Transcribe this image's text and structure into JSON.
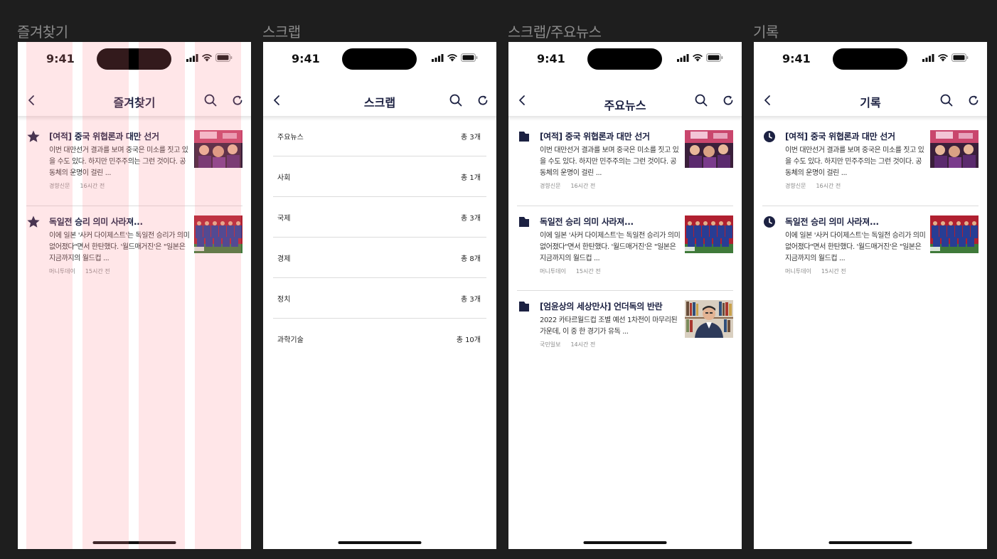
{
  "status_time": "9:41",
  "frames": [
    {
      "label": "즐겨찾기",
      "nav_title": "즐겨찾기"
    },
    {
      "label": "스크랩",
      "nav_title": "스크랩"
    },
    {
      "label": "스크랩/주요뉴스",
      "nav_title": "주요뉴스"
    },
    {
      "label": "기록",
      "nav_title": "기록"
    }
  ],
  "icons": {
    "favorite": "star-icon",
    "scrap": "folder-icon",
    "history": "clock-icon",
    "back": "chevron-left-icon",
    "search": "search-icon",
    "refresh": "refresh-icon"
  },
  "colors": {
    "accent": "#1c2142",
    "grid_overlay": "#ff828c"
  },
  "articles": {
    "a1": {
      "title": "[여적] 중국 위협론과 대만 선거",
      "summary": "이번 대만선거 결과를 보며 중국은 미소를 짓고 있을 수도 있다. 하지만 민주주의는 그런 것이다. 공동체의 운명이 걸린 ...",
      "source": "경향신문",
      "time": "16시간 전"
    },
    "a2": {
      "title": "독일전 승리 의미 사라져...",
      "summary": "이에 일본 '사커 다이제스트'는 독일전 승리가 의미 없어졌다\"면서 한탄했다. '월드매거진'은 \"일본은 지금까지의 월드컵 ...",
      "source": "머니투데이",
      "time": "15시간 전"
    },
    "a3": {
      "title": "[엄윤상의 세상만사] 언더독의 반란",
      "summary": "2022 카타르월드컵 조별 예선 1차전이 마무리된 가운데, 이 중 한 경기가 유독 ...",
      "source": "국민일보",
      "time": "14시간 전"
    }
  },
  "scrap_categories": [
    {
      "name": "주요뉴스",
      "count": "총 3개"
    },
    {
      "name": "사회",
      "count": "총 1개"
    },
    {
      "name": "국제",
      "count": "총 3개"
    },
    {
      "name": "경제",
      "count": "총 8개"
    },
    {
      "name": "정치",
      "count": "총 3개"
    },
    {
      "name": "과학기술",
      "count": "총 10개"
    }
  ]
}
